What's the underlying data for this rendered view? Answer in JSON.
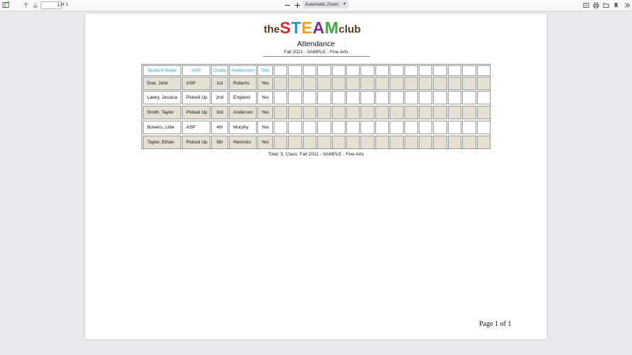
{
  "toolbar": {
    "page_number": "1",
    "page_of": "of 1",
    "zoom": "Automatic Zoom"
  },
  "document": {
    "logo": {
      "the": "the",
      "steam_letters": [
        "S",
        "T",
        "E",
        "A",
        "M"
      ],
      "club": "club"
    },
    "colors": {
      "S": "#e2232a",
      "T": "#1d9bd7",
      "E": "#f6a01a",
      "A": "#7b2f8e",
      "M": "#3fa842",
      "header_text": "#29abe2",
      "shade": "#e6e0d2"
    },
    "title": "Attendance",
    "subtitle": "Fall 2021 - SAMPLE - Fine Arts",
    "columns": [
      "Student Name",
      "ASP",
      "Grade",
      "Homeroom",
      "Text"
    ],
    "rows": [
      {
        "name": "Doe, John",
        "asp": "ASP",
        "grade": "1st",
        "homeroom": "Roberts",
        "text": "Yes"
      },
      {
        "name": "Lawry, Jessica",
        "asp": "Picked Up",
        "grade": "2nd",
        "homeroom": "England",
        "text": "Yes"
      },
      {
        "name": "Smith, Taylor",
        "asp": "Picked Up",
        "grade": "3rd",
        "homeroom": "Anderson",
        "text": "Yes"
      },
      {
        "name": "Bowers, Lillie",
        "asp": "ASP",
        "grade": "4th",
        "homeroom": "Murphy",
        "text": "Yes"
      },
      {
        "name": "Taylor, Ethan",
        "asp": "Picked Up",
        "grade": "5th",
        "homeroom": "Henricks",
        "text": "Yes"
      }
    ],
    "total": "Total: 5, Class: Fall 2021 - SAMPLE - Fine Arts",
    "page_footer": "Page 1 of 1"
  }
}
